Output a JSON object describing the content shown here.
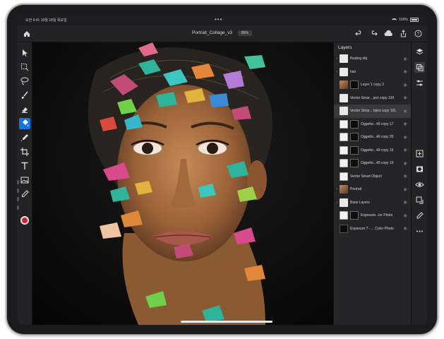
{
  "status": {
    "time": "오전 9:41",
    "date": "10월 18일 목요일",
    "dots": "•••",
    "battery": "100%"
  },
  "topbar": {
    "doc_title": "Portrait_Collage_v3",
    "zoom": "86%",
    "actions": [
      "undo-icon",
      "redo-icon",
      "cloud-icon",
      "share-icon",
      "help-icon"
    ]
  },
  "tools": [
    "move-icon",
    "marquee-icon",
    "lasso-icon",
    "brush-icon",
    "eraser-icon",
    "fill-icon",
    "dropper-brush-icon",
    "crop-icon",
    "type-icon",
    "image-icon",
    "eyedropper-icon"
  ],
  "active_tool": "fill-icon",
  "foreground_color": "#d81c2a",
  "layers_panel": {
    "title": "Layers",
    "layers": [
      {
        "name": "floating obj",
        "group": true,
        "thumb": "plain"
      },
      {
        "name": "hair",
        "group": true,
        "thumb": "plain"
      },
      {
        "name": "Layer 1 copy 3",
        "thumb": "photo",
        "mask": true
      },
      {
        "name": "Vector Smar... ject copy 193",
        "thumb": "plain"
      },
      {
        "name": "Vector Smar... bject copy 191",
        "thumb": "plain",
        "selected": true
      },
      {
        "name": "Oggetto...49 copy 17",
        "thumb": "sketch",
        "mask": true
      },
      {
        "name": "Oggetto...49 copy 20",
        "thumb": "sketch",
        "mask": true
      },
      {
        "name": "Oggetto...49 copy 16",
        "thumb": "sketch",
        "mask": true
      },
      {
        "name": "Oggetto...49 copy 19",
        "thumb": "sketch",
        "mask": true
      },
      {
        "name": "Vector Smart Object",
        "thumb": "sketch"
      },
      {
        "name": "Portrait",
        "group": true,
        "thumb": "photo"
      },
      {
        "name": "Base Layers",
        "group": true,
        "thumb": "plain"
      },
      {
        "name": "Exposure...lor Photo",
        "thumb": "sketch",
        "mask": true
      },
      {
        "name": "Exposure ? - ... Color Photo",
        "thumb": "dark"
      }
    ]
  },
  "properties": [
    "layers-stack-icon",
    "layer-props-icon",
    "adjust-icon",
    "add-layer-icon",
    "mask-icon",
    "visibility-icon",
    "merge-icon",
    "clear-icon",
    "more-icon"
  ],
  "colors": {
    "accent": "#1473e6",
    "panel": "#252527",
    "canvas": "#0e0e0e"
  }
}
